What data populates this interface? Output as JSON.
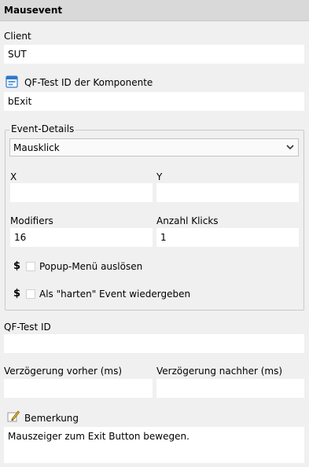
{
  "window": {
    "title": "Mausevent"
  },
  "client": {
    "label": "Client",
    "value": "SUT"
  },
  "component": {
    "label": "QF-Test ID der Komponente",
    "value": "bExit"
  },
  "event_details": {
    "title": "Event-Details",
    "event_type": "Mausklick",
    "x": {
      "label": "X",
      "value": ""
    },
    "y": {
      "label": "Y",
      "value": ""
    },
    "modifiers": {
      "label": "Modifiers",
      "value": "16"
    },
    "click_count": {
      "label": "Anzahl Klicks",
      "value": "1"
    },
    "popup": {
      "label": "Popup-Menü auslösen",
      "checked": false,
      "var_marker": "$"
    },
    "hard_event": {
      "label": "Als \"harten\" Event wiedergeben",
      "checked": false,
      "var_marker": "$"
    }
  },
  "qftest_id": {
    "label": "QF-Test ID",
    "value": ""
  },
  "delay_before": {
    "label": "Verzögerung vorher (ms)",
    "value": ""
  },
  "delay_after": {
    "label": "Verzögerung nachher (ms)",
    "value": ""
  },
  "comment": {
    "label": "Bemerkung",
    "value": "Mauszeiger zum Exit Button bewegen."
  },
  "icons": {
    "component": "component-icon",
    "comment": "pencil-icon",
    "dropdown": "chevron-down-icon"
  },
  "colors": {
    "field_bg": "#ffffff",
    "panel_bg": "#f0f0f0",
    "title_bg": "#d9d9d9"
  }
}
